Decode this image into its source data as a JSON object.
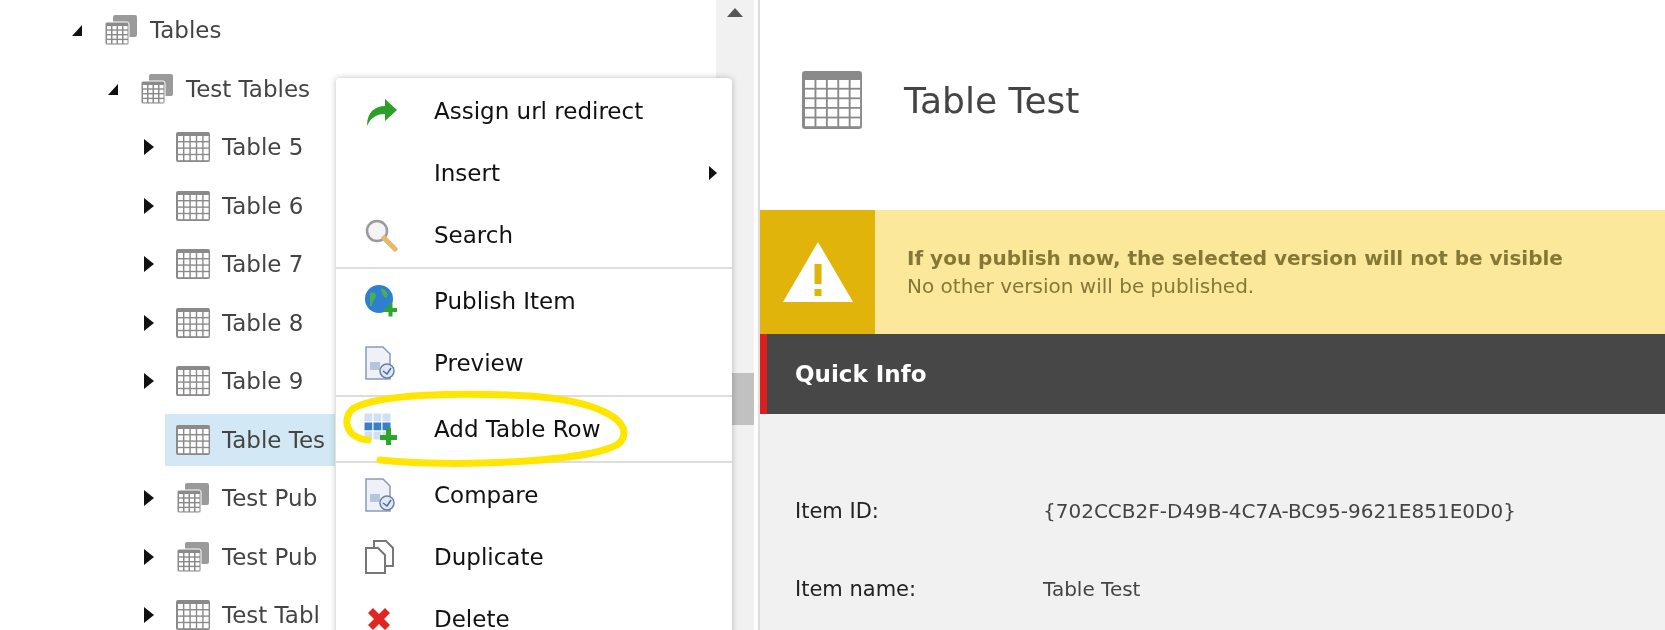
{
  "tree": [
    {
      "label": "Tables",
      "kind": "folder",
      "expanded": true,
      "selected": false,
      "children": [
        {
          "label": "Test Tables",
          "kind": "folder",
          "expanded": true,
          "selected": false,
          "children": [
            {
              "label": "Table 5",
              "kind": "table",
              "expanded": false,
              "selected": false
            },
            {
              "label": "Table 6",
              "kind": "table",
              "expanded": false,
              "selected": false
            },
            {
              "label": "Table 7",
              "kind": "table",
              "expanded": false,
              "selected": false
            },
            {
              "label": "Table 8",
              "kind": "table",
              "expanded": false,
              "selected": false
            },
            {
              "label": "Table 9",
              "kind": "table",
              "expanded": false,
              "selected": false
            },
            {
              "label": "Table Tes",
              "kind": "table",
              "selected": true
            },
            {
              "label": "Test Pub",
              "kind": "folder",
              "expanded": false,
              "selected": false
            },
            {
              "label": "Test Pub",
              "kind": "folder",
              "expanded": false,
              "selected": false
            },
            {
              "label": "Test Tabl",
              "kind": "table",
              "expanded": false,
              "selected": false
            }
          ]
        }
      ]
    }
  ],
  "context_menu": {
    "groups": [
      [
        {
          "label": "Assign url redirect",
          "submenu": false,
          "highlighted": false
        },
        {
          "label": "Insert",
          "submenu": true,
          "highlighted": false
        },
        {
          "label": "Search",
          "submenu": false,
          "highlighted": false
        }
      ],
      [
        {
          "label": "Publish Item",
          "submenu": false,
          "highlighted": false
        },
        {
          "label": "Preview",
          "submenu": false,
          "highlighted": false
        }
      ],
      [
        {
          "label": "Add Table Row",
          "submenu": false,
          "highlighted": true
        }
      ],
      [
        {
          "label": "Compare",
          "submenu": false,
          "highlighted": false
        },
        {
          "label": "Duplicate",
          "submenu": false,
          "highlighted": false
        },
        {
          "label": "Delete",
          "submenu": false,
          "highlighted": false
        }
      ]
    ]
  },
  "header": {
    "title": "Table Test"
  },
  "warning": {
    "title": "If you publish now, the selected version will not be visible",
    "message": "No other version will be published."
  },
  "quick_info": {
    "title": "Quick Info",
    "fields": [
      {
        "label": "Item ID:",
        "value": "{702CCB2F-D49B-4C7A-BC95-9621E851E0D0}"
      },
      {
        "label": "Item name:",
        "value": "Table Test"
      }
    ]
  }
}
